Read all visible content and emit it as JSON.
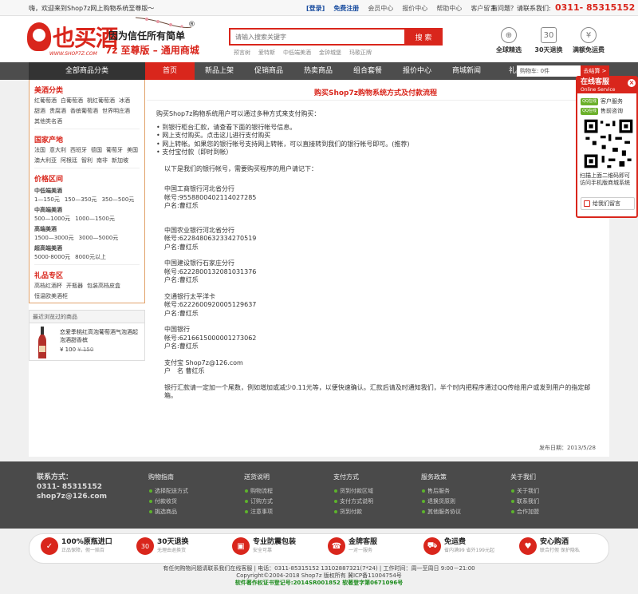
{
  "topbar": {
    "welcome": "嗨，欢迎来到Shop7z网上购物系统至尊版～",
    "login": "[登录]",
    "register": "免费注册",
    "links": [
      "会员中心",
      "报价中心",
      "帮助中心",
      "客户留言"
    ],
    "question": "有问题？请联系我们:",
    "phone": "0311- 85315152"
  },
  "header": {
    "logo_text": "也买酒",
    "logo_url": "WWW.SHOP7Z.COM",
    "slogan": "因为信任所有简单",
    "reg_mark": "®",
    "sub_slogan": "7z 至尊版 – 通用商城",
    "search_placeholder": "请输入搜索关键字",
    "search_button": "搜 索",
    "hot_words": [
      "预言树",
      "爱特斯",
      "中低端美酒",
      "金钟城堡",
      "玛歌正牌"
    ],
    "promises": [
      {
        "icon": "globe-icon",
        "glyph": "⊕",
        "label": "全球精选"
      },
      {
        "icon": "calendar-icon",
        "glyph": "30",
        "label": "30天退换"
      },
      {
        "icon": "yen-icon",
        "glyph": "¥",
        "label": "满额免运费"
      }
    ]
  },
  "nav": {
    "all_categories": "全部商品分类",
    "items": [
      "首页",
      "新品上架",
      "促销商品",
      "热卖商品",
      "组合套餐",
      "报价中心",
      "商城新闻",
      "礼品兑换"
    ],
    "active_index": 0,
    "cart_label": "购物车: 0件",
    "checkout_label": "去结算 >"
  },
  "sidebar": {
    "sections": [
      {
        "title": "美酒分类",
        "items": [
          "红葡萄酒",
          "白葡萄酒",
          "桃红葡萄酒",
          "冰酒",
          "甜酒",
          "贵腐酒",
          "香槟葡萄酒",
          "世界明庄酒",
          "其他类名酒"
        ]
      },
      {
        "title": "国家产地",
        "items": [
          "法国",
          "意大利",
          "西班牙",
          "德国",
          "葡萄牙",
          "美国",
          "澳大利亚",
          "阿根廷",
          "智利",
          "南非",
          "新加坡"
        ]
      },
      {
        "title": "价格区间",
        "groups": [
          {
            "name": "中低端美酒",
            "items": [
              "1—150元",
              "150—350元",
              "350—500元"
            ]
          },
          {
            "name": "中高端美酒",
            "items": [
              "500—1000元",
              "1000—1500元"
            ]
          },
          {
            "name": "高端美酒",
            "items": [
              "1500—3000元",
              "3000—5000元"
            ]
          },
          {
            "name": "超高端美酒",
            "items": [
              "5000-8000元",
              "8000元以上"
            ]
          }
        ]
      },
      {
        "title": "礼品专区",
        "items": [
          "高档红酒杯",
          "开瓶器",
          "包装高档皮盒",
          "恒温欧美酒柜"
        ]
      }
    ],
    "recent": {
      "title": "最近浏览过的商品",
      "product_name": "恋爱季桃红高泡葡萄酒气泡酒起泡酒甜香槟",
      "price": "¥ 100",
      "old_price": "¥ 150"
    }
  },
  "content": {
    "title": "购买Shop7z购物系统方式及付款流程",
    "intro": "购买Shop7z购物系统用户可以通过多种方式来支付购买：",
    "methods": [
      "到银行柜台汇款，请查看下面的银行帐号信息。",
      "网上支付购买。点击这儿进行支付购买",
      "网上转帐。如果您的银行帐号支持网上转帐，可以直接转到我们的银行帐号即可。(推荐)",
      "支付宝付款（即时到帐）"
    ],
    "accounts_intro": "以下是我们的银行帐号，需要购买程序的用户请记下：",
    "banks": [
      {
        "name": "中国工商银行河北省分行",
        "account": "帐号:9558800402114027285",
        "holder": "户名:曹红乐"
      },
      {
        "name": "中国农业银行河北省分行",
        "account": "帐号:6228480632334270519",
        "holder": "户名:曹红乐"
      },
      {
        "name": "中国建设银行石家庄分行",
        "account": "帐号:6222800132081031376",
        "holder": "户名:曹红乐"
      },
      {
        "name": "交通银行太平洋卡",
        "account": "帐号:6222600920005129637",
        "holder": "户名:曹红乐"
      },
      {
        "name": "中国银行",
        "account": "帐号:6216615000001273062",
        "holder": "户名:曹红乐"
      },
      {
        "name": "支付宝 Shop7z@126.com",
        "account": "",
        "holder": "户　名 曹红乐"
      }
    ],
    "note": "银行汇款请一定加一个尾数，例如增加或减少0.11元等，以便快速确认。汇款后请及时通知我们，半个时内把程序通过QQ传给用户或发到用户的指定邮箱。",
    "publish_date": "发布日期：2013/5/28"
  },
  "service": {
    "title": "在线客服",
    "subtitle": "Online Service",
    "close": "×",
    "qq_badge": "QQ在线",
    "qq": [
      "客户服务",
      "售前咨询"
    ],
    "qr_text": "扫描上面二维码即可访问手机版商城系统",
    "message": "给我们留言"
  },
  "footer": {
    "contact_title": "联系方式：",
    "contact_phone": "0311- 85315152",
    "contact_email": "shop7z@126.com",
    "columns": [
      {
        "title": "购物指南",
        "items": [
          "选择配送方式",
          "付款收货",
          "挑选商品"
        ]
      },
      {
        "title": "送货说明",
        "items": [
          "购物流程",
          "订购方式",
          "注意事项"
        ]
      },
      {
        "title": "支付方式",
        "items": [
          "货到付款区域",
          "支付方式说明",
          "货到付款"
        ]
      },
      {
        "title": "服务政策",
        "items": [
          "售后服务",
          "退换货原则",
          "其他服务协议"
        ]
      },
      {
        "title": "关于我们",
        "items": [
          "关于我们",
          "联系我们",
          "合作加盟"
        ]
      }
    ]
  },
  "strip": [
    {
      "icon": "genuine-icon",
      "glyph": "✓",
      "t1": "100%原瓶进口",
      "t2": "正品保障，假一赔百"
    },
    {
      "icon": "return-icon",
      "glyph": "30",
      "t1": "30天退换",
      "t2": "无理由退换货"
    },
    {
      "icon": "package-icon",
      "glyph": "▣",
      "t1": "专业防震包装",
      "t2": "安全可靠"
    },
    {
      "icon": "support-icon",
      "glyph": "☎",
      "t1": "金牌客服",
      "t2": "一对一服务"
    },
    {
      "icon": "shipping-icon",
      "glyph": "⛟",
      "t1": "免运费",
      "t2": "省内满99 省外199元起"
    },
    {
      "icon": "heart-icon",
      "glyph": "♥",
      "t1": "安心购酒",
      "t2": "联合打假 保护隐私"
    }
  ],
  "bottom": {
    "line1": "有任何购物问题请联系我们在线客服 | 电话：0311-85315152 13102887321(7*24) | 工作时间：周一至周日 9:00－21:00",
    "line2": "Copyright©2004-2018 Shop7z 版权所有  冀ICP备11004754号",
    "line3": "软件著作权证书登记号:2014SR001852 软著登字第0671096号"
  }
}
